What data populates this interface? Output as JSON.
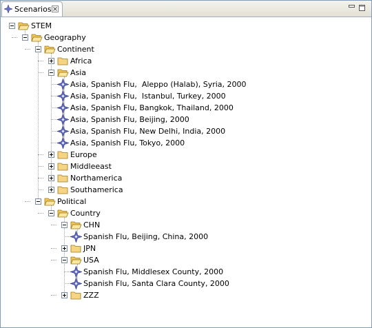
{
  "view": {
    "tab_label": "Scenarios",
    "minimize_icon": "minimize-icon",
    "maximize_icon": "maximize-icon"
  },
  "colors": {
    "folder": "#f5d583",
    "scenario": "#6a74c6",
    "accent": "#316ac5"
  },
  "tree": [
    {
      "label": "STEM",
      "type": "folder",
      "expanded": true
    },
    {
      "label": "Geography",
      "type": "folder",
      "expanded": true
    },
    {
      "label": "Continent",
      "type": "folder",
      "expanded": true
    },
    {
      "label": "Africa",
      "type": "folder",
      "expanded": false
    },
    {
      "label": "Asia",
      "type": "folder",
      "expanded": true
    },
    {
      "label": "Asia, Spanish Flu,  Aleppo (Halab), Syria, 2000",
      "type": "scenario"
    },
    {
      "label": "Asia, Spanish Flu,  Istanbul, Turkey, 2000",
      "type": "scenario"
    },
    {
      "label": "Asia, Spanish Flu, Bangkok, Thailand, 2000",
      "type": "scenario"
    },
    {
      "label": "Asia, Spanish Flu, Beijing, 2000",
      "type": "scenario"
    },
    {
      "label": "Asia, Spanish Flu, New Delhi, India, 2000",
      "type": "scenario"
    },
    {
      "label": "Asia, Spanish Flu, Tokyo, 2000",
      "type": "scenario"
    },
    {
      "label": "Europe",
      "type": "folder",
      "expanded": false
    },
    {
      "label": "Middleeast",
      "type": "folder",
      "expanded": false
    },
    {
      "label": "Northamerica",
      "type": "folder",
      "expanded": false
    },
    {
      "label": "Southamerica",
      "type": "folder",
      "expanded": false
    },
    {
      "label": "Political",
      "type": "folder",
      "expanded": true
    },
    {
      "label": "Country",
      "type": "folder",
      "expanded": true
    },
    {
      "label": "CHN",
      "type": "folder",
      "expanded": true
    },
    {
      "label": "Spanish Flu, Beijing, China, 2000",
      "type": "scenario"
    },
    {
      "label": "JPN",
      "type": "folder",
      "expanded": false
    },
    {
      "label": "USA",
      "type": "folder",
      "expanded": true
    },
    {
      "label": "Spanish Flu, Middlesex County, 2000",
      "type": "scenario"
    },
    {
      "label": "Spanish Flu, Santa Clara County, 2000",
      "type": "scenario"
    },
    {
      "label": "ZZZ",
      "type": "folder",
      "expanded": false
    }
  ]
}
